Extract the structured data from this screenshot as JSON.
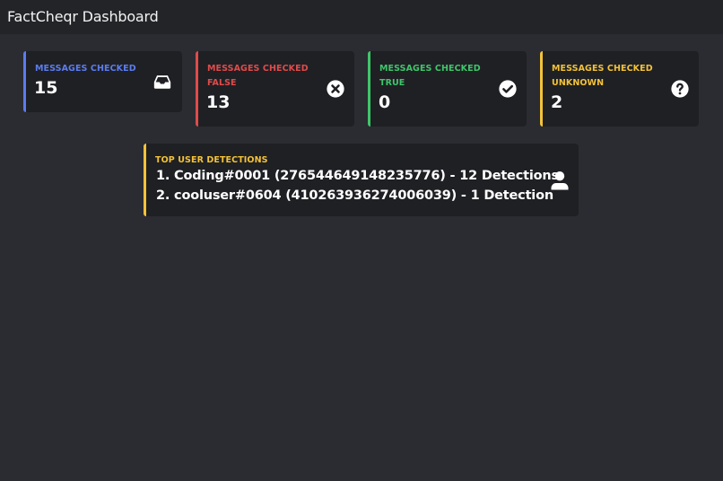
{
  "app": {
    "title": "FactCheqr Dashboard"
  },
  "colors": {
    "blue": "#5b7cf0",
    "red": "#e04b4b",
    "green": "#3fc66a",
    "yellow": "#f3c238"
  },
  "cards": [
    {
      "label": "MESSAGES CHECKED",
      "value": "15",
      "icon": "inbox-icon"
    },
    {
      "label": "MESSAGES CHECKED FALSE",
      "value": "13",
      "icon": "x-circle-icon"
    },
    {
      "label": "MESSAGES CHECKED TRUE",
      "value": "0",
      "icon": "check-circle-icon"
    },
    {
      "label": "MESSAGES CHECKED UNKNOWN",
      "value": "2",
      "icon": "question-circle-icon"
    }
  ],
  "top_users": {
    "label": "TOP USER DETECTIONS",
    "entries": [
      "1. Coding#0001 (276544649148235776) - 12 Detections",
      "2. cooluser#0604 (410263936274006039) - 1 Detection"
    ],
    "icon": "user-icon"
  }
}
